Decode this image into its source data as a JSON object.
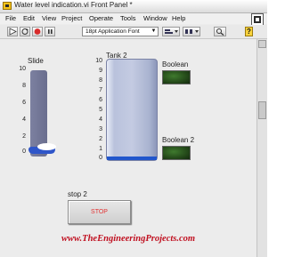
{
  "window": {
    "title": "Water level indication.vi Front Panel *"
  },
  "menu": [
    "File",
    "Edit",
    "View",
    "Project",
    "Operate",
    "Tools",
    "Window",
    "Help"
  ],
  "toolbar": {
    "font_select": "18pt Application Font",
    "icons": [
      "run-arrow-icon",
      "run-continuous-icon",
      "abort-icon",
      "pause-icon",
      "align-icon",
      "distribute-icon",
      "search-icon",
      "help-icon"
    ]
  },
  "slide": {
    "label": "Slide",
    "scale": [
      "10",
      "8",
      "6",
      "4",
      "2",
      "0"
    ],
    "value": 0,
    "fill_color": "#2f56c9"
  },
  "tank": {
    "label": "Tank 2",
    "scale": [
      "10",
      "9",
      "8",
      "7",
      "6",
      "5",
      "4",
      "3",
      "2",
      "1",
      "0"
    ],
    "value": 0,
    "fill_color": "#2156cc"
  },
  "boolean1": {
    "label": "Boolean",
    "state": false,
    "color": "#264d1b"
  },
  "boolean2": {
    "label": "Boolean 2",
    "state": false,
    "color": "#264d1b"
  },
  "stop": {
    "label": "stop 2",
    "button_text": "STOP"
  },
  "watermark": "www.TheEngineeringProjects.com"
}
